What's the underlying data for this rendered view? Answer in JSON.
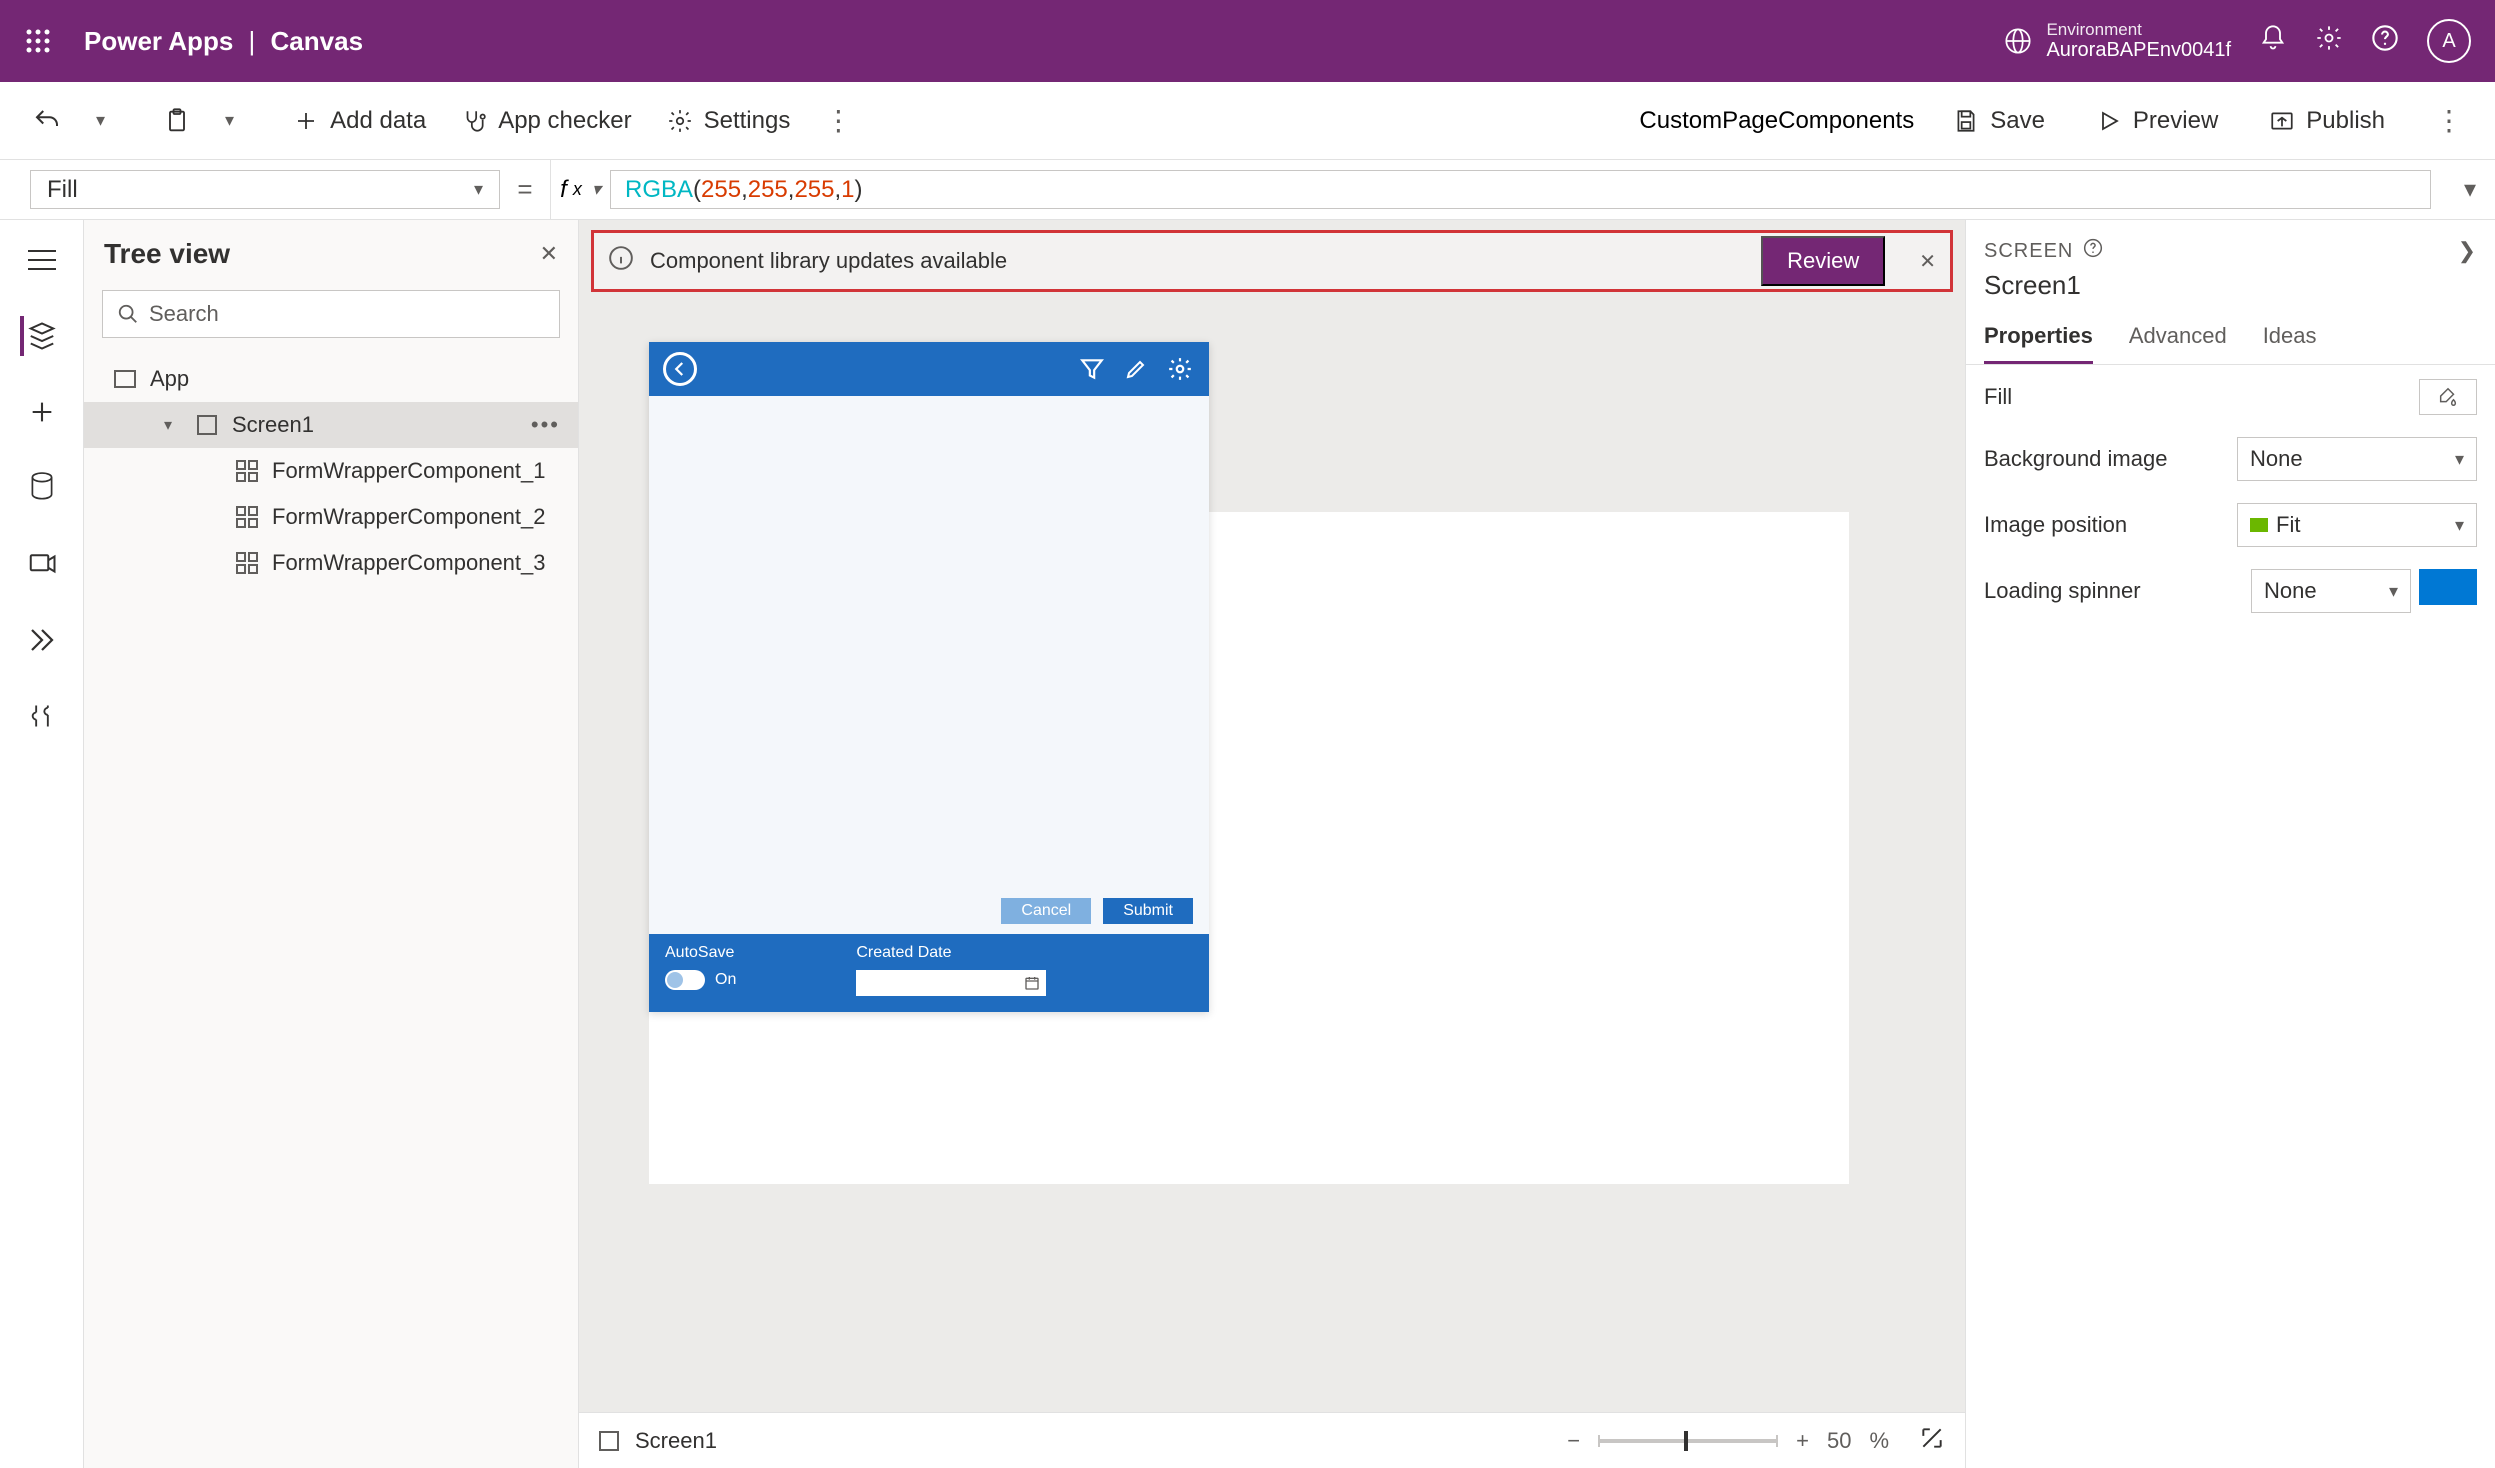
{
  "header": {
    "product": "Power Apps",
    "subtitle": "Canvas",
    "env_label": "Environment",
    "env_name": "AuroraBAPEnv0041f",
    "avatar_initial": "A"
  },
  "cmdbar": {
    "add_data": "Add data",
    "app_checker": "App checker",
    "settings": "Settings",
    "page_name": "CustomPageComponents",
    "save": "Save",
    "preview": "Preview",
    "publish": "Publish"
  },
  "formula": {
    "property": "Fill",
    "fn": "RGBA",
    "args": [
      "255",
      "255",
      "255",
      "1"
    ]
  },
  "tree": {
    "title": "Tree view",
    "search_placeholder": "Search",
    "app_label": "App",
    "screen_label": "Screen1",
    "children": [
      "FormWrapperComponent_1",
      "FormWrapperComponent_2",
      "FormWrapperComponent_3"
    ]
  },
  "notification": {
    "text": "Component library updates available",
    "button": "Review"
  },
  "phone": {
    "cancel": "Cancel",
    "submit": "Submit",
    "autosave_label": "AutoSave",
    "autosave_value": "On",
    "created_label": "Created Date"
  },
  "statusbar": {
    "screen": "Screen1",
    "zoom": "50",
    "pct": "%"
  },
  "right": {
    "head": "SCREEN",
    "title": "Screen1",
    "tabs": {
      "properties": "Properties",
      "advanced": "Advanced",
      "ideas": "Ideas"
    },
    "rows": {
      "fill": "Fill",
      "bg_image": "Background image",
      "bg_image_value": "None",
      "img_pos": "Image position",
      "img_pos_value": "Fit",
      "spinner": "Loading spinner",
      "spinner_value": "None"
    }
  }
}
